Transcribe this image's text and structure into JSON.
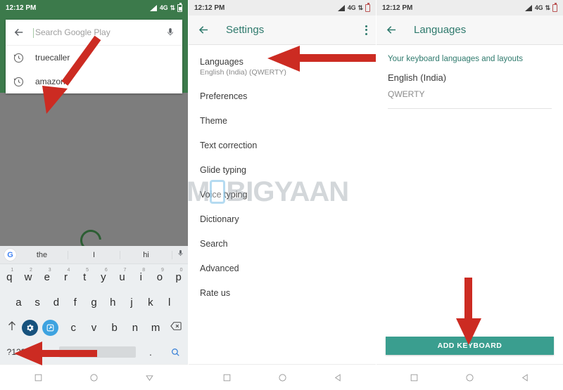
{
  "statusbar": {
    "time": "12:12 PM",
    "network": "4G",
    "signal_icon": "signal-bars-icon",
    "data_icon": "data-transfer-icon",
    "battery_icon": "battery-icon"
  },
  "panel1": {
    "name": "google-play-search",
    "search": {
      "placeholder": "Search Google Play",
      "value": "",
      "back_icon": "back-arrow-icon",
      "mic_icon": "microphone-icon"
    },
    "suggestions": [
      {
        "label": "truecaller",
        "icon": "history-clock-icon"
      },
      {
        "label": "amazon",
        "icon": "history-clock-icon"
      }
    ],
    "loading_icon": "loading-spinner-icon",
    "keyboard": {
      "suggestion_bar": {
        "logo": "google-g-logo",
        "words": [
          "the",
          "I",
          "hi"
        ],
        "mic_icon": "microphone-icon"
      },
      "row1": [
        {
          "key": "q",
          "num": "1"
        },
        {
          "key": "w",
          "num": "2"
        },
        {
          "key": "e",
          "num": "3"
        },
        {
          "key": "r",
          "num": "4"
        },
        {
          "key": "t",
          "num": "5"
        },
        {
          "key": "y",
          "num": "6"
        },
        {
          "key": "u",
          "num": "7"
        },
        {
          "key": "i",
          "num": "8"
        },
        {
          "key": "o",
          "num": "9"
        },
        {
          "key": "p",
          "num": "0"
        }
      ],
      "row2": [
        "a",
        "s",
        "d",
        "f",
        "g",
        "h",
        "j",
        "k",
        "l"
      ],
      "row3": [
        "c",
        "v",
        "b",
        "n",
        "m"
      ],
      "shift_icon": "shift-arrow-up-icon",
      "settings_icon": "gear-icon",
      "switch_icon": "keyboard-switch-icon",
      "backspace_icon": "backspace-icon",
      "symbols_key": "?123",
      "comma_key": ",",
      "period_key": ".",
      "space_key": "",
      "search_icon": "search-magnifier-icon"
    }
  },
  "panel2": {
    "name": "keyboard-settings",
    "appbar": {
      "title": "Settings",
      "back_icon": "back-arrow-icon",
      "menu_icon": "overflow-menu-icon"
    },
    "items": [
      {
        "label": "Languages",
        "sub": "English (India) (QWERTY)"
      },
      {
        "label": "Preferences",
        "sub": ""
      },
      {
        "label": "Theme",
        "sub": ""
      },
      {
        "label": "Text correction",
        "sub": ""
      },
      {
        "label": "Glide typing",
        "sub": ""
      },
      {
        "label": "Voice typing",
        "sub": ""
      },
      {
        "label": "Dictionary",
        "sub": ""
      },
      {
        "label": "Search",
        "sub": ""
      },
      {
        "label": "Advanced",
        "sub": ""
      },
      {
        "label": "Rate us",
        "sub": ""
      }
    ]
  },
  "panel3": {
    "name": "languages-screen",
    "appbar": {
      "title": "Languages",
      "back_icon": "back-arrow-icon"
    },
    "section_header": "Your keyboard languages and layouts",
    "language": {
      "label": "English (India)",
      "layout": "QWERTY"
    },
    "add_button": "ADD KEYBOARD"
  },
  "navbar": {
    "recents_icon": "recents-square-icon",
    "home_icon": "home-circle-icon",
    "back_icon": "back-triangle-icon"
  },
  "watermark": {
    "text_left": "M",
    "text_right": "BIGYAAN"
  },
  "colors": {
    "play_green": "#3c7a4b",
    "teal_accent": "#2f7a6d",
    "add_button_teal": "#3a9e8f",
    "arrow_red": "#cc2b22",
    "key_text": "#2b2b2b"
  },
  "annotations": [
    {
      "name": "arrow-to-keyboard-settings-gear",
      "direction": "down-left"
    },
    {
      "name": "arrow-to-comma-key",
      "direction": "left"
    },
    {
      "name": "arrow-to-languages-row",
      "direction": "left"
    },
    {
      "name": "arrow-to-add-keyboard-button",
      "direction": "down"
    }
  ]
}
